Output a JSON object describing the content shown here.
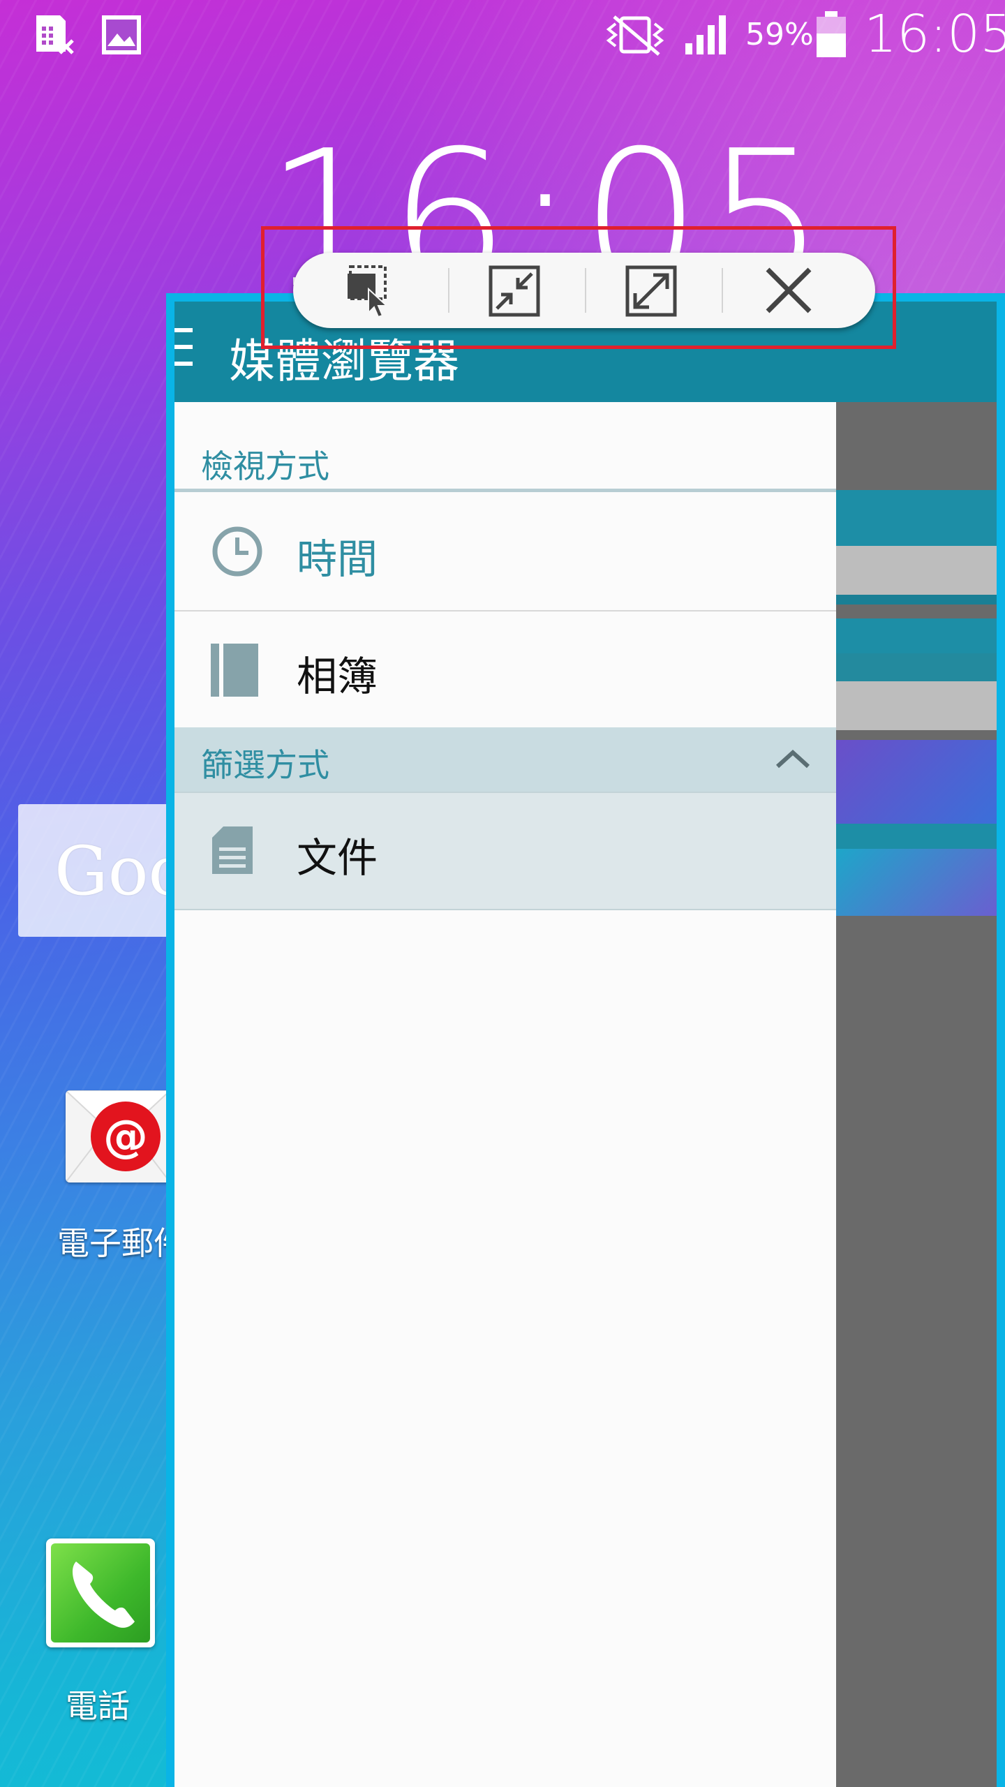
{
  "status_bar": {
    "icons": [
      "sim-card-error-icon",
      "image-notification-icon",
      "vibrate-mute-icon",
      "signal-icon",
      "battery-icon"
    ],
    "battery": "59%",
    "time": "16:05"
  },
  "lock_clock": {
    "time": "16:05"
  },
  "home": {
    "google_widget": {
      "text": "Goo"
    },
    "apps": [
      {
        "label": "電子郵件",
        "icon": "email-icon"
      },
      {
        "label": "電話",
        "icon": "phone-icon"
      }
    ]
  },
  "popup": {
    "title": "媒體瀏覽器",
    "view_section": {
      "header": "檢視方式",
      "items": [
        {
          "label": "時間",
          "icon": "clock-icon",
          "selected": true
        },
        {
          "label": "相簿",
          "icon": "album-icon",
          "selected": false
        }
      ]
    },
    "filter_section": {
      "header": "篩選方式",
      "items": [
        {
          "label": "文件",
          "icon": "document-icon"
        }
      ]
    },
    "toolbar": {
      "buttons": [
        "drag-move-icon",
        "minimize-icon",
        "maximize-icon",
        "close-icon"
      ]
    },
    "colors": {
      "accent": "#2f8ea2",
      "app_bar": "#14879f",
      "window_border": "#0ab4e6",
      "highlight": "#e0202e"
    }
  }
}
